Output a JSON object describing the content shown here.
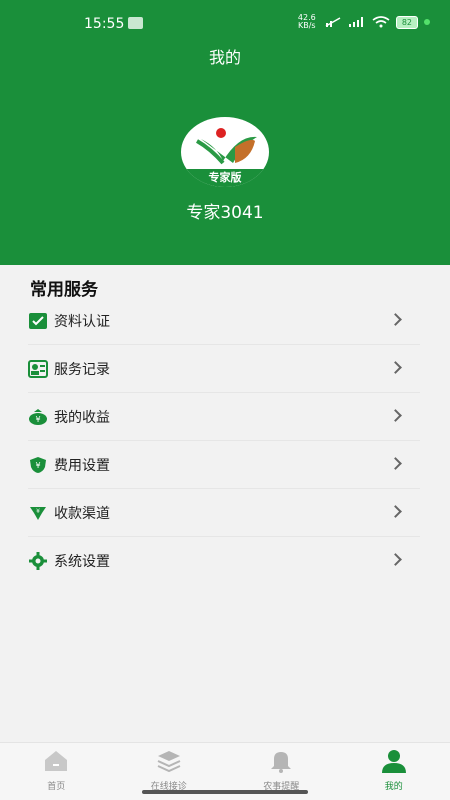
{
  "status": {
    "time": "15:55",
    "net_speed_value": "42.6",
    "net_speed_unit": "KB/s",
    "battery": "82"
  },
  "header": {
    "title": "我的",
    "avatar_badge": "专家版",
    "username": "专家3041"
  },
  "services": {
    "title": "常用服务",
    "items": [
      {
        "label": "资料认证",
        "icon": "id-verify-icon"
      },
      {
        "label": "服务记录",
        "icon": "record-card-icon"
      },
      {
        "label": "我的收益",
        "icon": "money-bag-icon"
      },
      {
        "label": "费用设置",
        "icon": "fee-shield-icon"
      },
      {
        "label": "收款渠道",
        "icon": "payment-channel-icon"
      },
      {
        "label": "系统设置",
        "icon": "gear-icon"
      }
    ]
  },
  "tabs": [
    {
      "label": "首页",
      "icon": "home-icon"
    },
    {
      "label": "在线接诊",
      "icon": "layers-icon"
    },
    {
      "label": "农事提醒",
      "icon": "bell-icon"
    },
    {
      "label": "我的",
      "icon": "person-icon",
      "active": true
    }
  ],
  "colors": {
    "brand": "#1a8f3a",
    "background": "#f2f2f2"
  }
}
